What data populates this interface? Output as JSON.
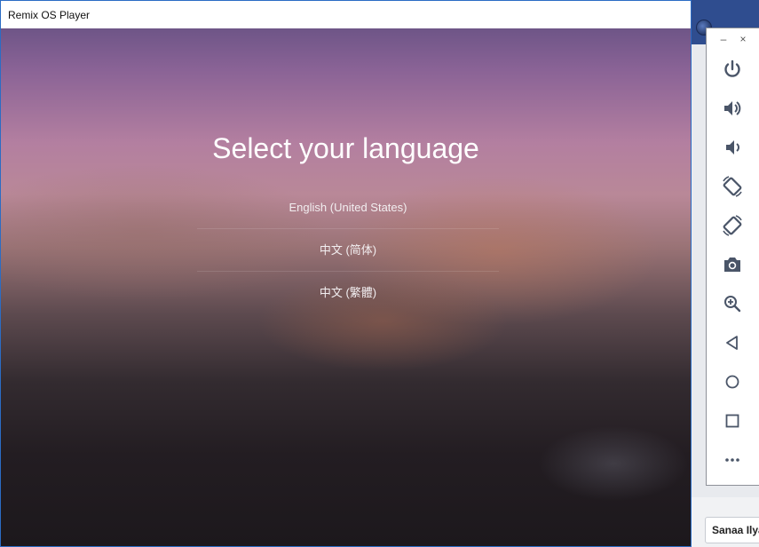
{
  "window": {
    "title": "Remix OS Player"
  },
  "setup": {
    "heading": "Select your language",
    "languages": [
      "English (United States)",
      "中文 (简体)",
      "中文 (繁體)"
    ]
  },
  "toolbar": {
    "minimize_glyph": "–",
    "close_glyph": "×",
    "buttons": [
      "power-icon",
      "volume-up-icon",
      "volume-down-icon",
      "rotate-left-icon",
      "rotate-right-icon",
      "camera-icon",
      "zoom-in-icon",
      "back-icon",
      "home-icon",
      "recents-icon",
      "more-icon"
    ]
  },
  "desktop": {
    "user_chip": "Sanaa Ilyas"
  },
  "colors": {
    "accent": "#2b6cc4",
    "icon": "#4a5568",
    "text_light": "#ffffff"
  }
}
